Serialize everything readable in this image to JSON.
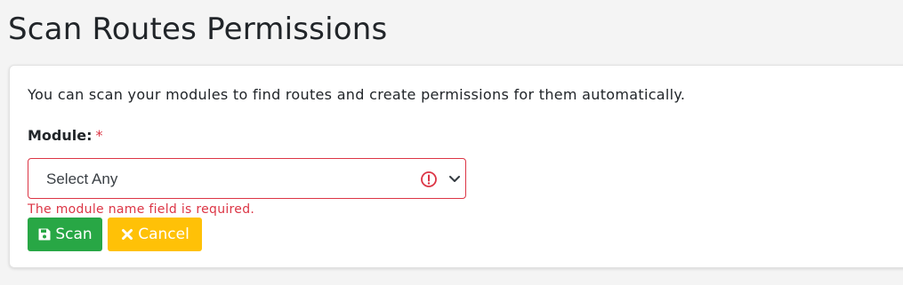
{
  "page": {
    "title": "Scan Routes Permissions"
  },
  "card": {
    "intro_text": "You can scan your modules to find routes and create permissions for them automatically.",
    "module_field": {
      "label": "Module:",
      "required_marker": "*",
      "selected_value": "Select Any",
      "error_message": "The module name field is required.",
      "validation_icon": "exclamation-circle-icon",
      "dropdown_icon": "chevron-down-icon"
    },
    "buttons": {
      "scan_label": "Scan",
      "scan_icon": "save-icon",
      "cancel_label": "Cancel",
      "cancel_icon": "times-icon"
    }
  },
  "colors": {
    "background": "#f4f4f4",
    "danger": "#dc3545",
    "success": "#28a745",
    "warning": "#ffc107"
  }
}
